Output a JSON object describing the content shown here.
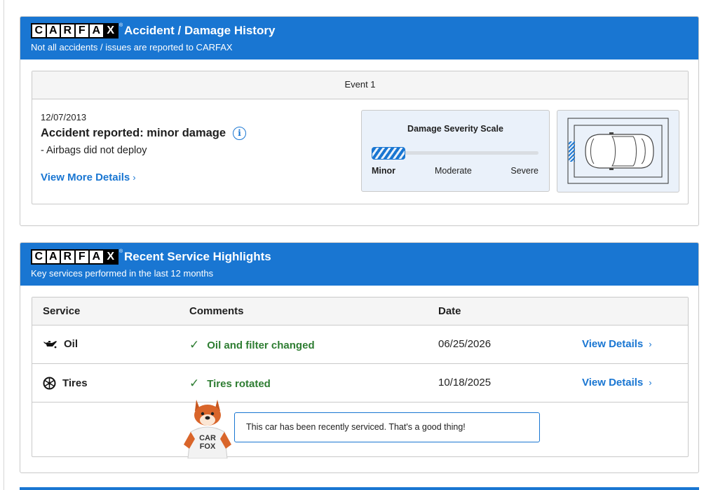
{
  "accident_card": {
    "logo_letters": [
      "C",
      "A",
      "R",
      "F",
      "A",
      "X"
    ],
    "logo_registered": "®",
    "title": "Accident / Damage History",
    "subtitle": "Not all accidents / issues are reported to CARFAX",
    "event": {
      "header": "Event 1",
      "date": "12/07/2013",
      "title": "Accident reported: minor damage",
      "note": "- Airbags did not deploy",
      "link": "View More Details"
    },
    "severity": {
      "title": "Damage Severity Scale",
      "labels": [
        "Minor",
        "Moderate",
        "Severe"
      ],
      "level_fraction": 0.2
    }
  },
  "service_card": {
    "logo_letters": [
      "C",
      "A",
      "R",
      "F",
      "A",
      "X"
    ],
    "logo_registered": "®",
    "title": "Recent Service Highlights",
    "subtitle": "Key services performed in the last 12 months",
    "columns": [
      "Service",
      "Comments",
      "Date"
    ],
    "rows": [
      {
        "service": "Oil",
        "icon": "oil-can-icon",
        "comment": "Oil and filter changed",
        "date": "06/25/2026",
        "link": "View Details"
      },
      {
        "service": "Tires",
        "icon": "tire-icon",
        "comment": "Tires rotated",
        "date": "10/18/2025",
        "link": "View Details"
      }
    ],
    "mascot_shirt": [
      "CAR",
      "FOX"
    ],
    "callout": "This car has been recently serviced. That's a good thing!"
  },
  "colors": {
    "brand_blue": "#1976d2",
    "success_green": "#2e7d32"
  }
}
